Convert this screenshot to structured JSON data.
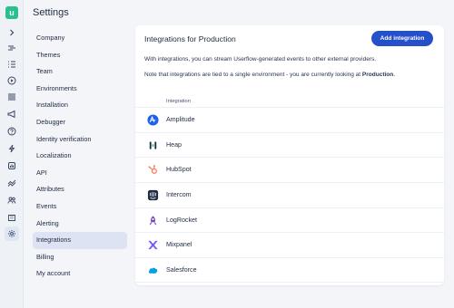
{
  "app": {
    "logo_glyph": "u",
    "brand_color": "#29c08c",
    "accent_color": "#2450c9"
  },
  "rail": {
    "icons": [
      "chevron-right-icon",
      "flows-icon",
      "checklists-icon",
      "play-icon",
      "list-icon",
      "megaphone-icon",
      "help-icon",
      "bolt-icon",
      "analytics-icon",
      "trend-icon",
      "users-icon",
      "building-icon",
      "gear-icon"
    ],
    "active": "gear-icon"
  },
  "settings": {
    "title": "Settings",
    "menu": [
      "Company",
      "Themes",
      "Team",
      "Environments",
      "Installation",
      "Debugger",
      "Identity verification",
      "Localization",
      "API",
      "Attributes",
      "Events",
      "Alerting",
      "Integrations",
      "Billing",
      "My account"
    ],
    "active_item": "Integrations"
  },
  "card": {
    "title": "Integrations for Production",
    "add_button": "Add integration",
    "desc1": "With integrations, you can stream Userflow-generated events to other external providers.",
    "desc2_prefix": "Note that integrations are tied to a single environment - you are currently looking at ",
    "desc2_env": "Production",
    "desc2_suffix": ".",
    "column_header": "Integration",
    "integrations": [
      {
        "name": "Amplitude",
        "icon": "amplitude-icon",
        "color": "#1e61f0"
      },
      {
        "name": "Heap",
        "icon": "heap-icon",
        "color": "#1b2a3f"
      },
      {
        "name": "HubSpot",
        "icon": "hubspot-icon",
        "color": "#ff7a59"
      },
      {
        "name": "Intercom",
        "icon": "intercom-icon",
        "color": "#1f2a44"
      },
      {
        "name": "LogRocket",
        "icon": "logrocket-icon",
        "color": "#764abc"
      },
      {
        "name": "Mixpanel",
        "icon": "mixpanel-icon",
        "color": "#7856ff"
      },
      {
        "name": "Salesforce",
        "icon": "salesforce-icon",
        "color": "#00a1e0"
      }
    ]
  }
}
